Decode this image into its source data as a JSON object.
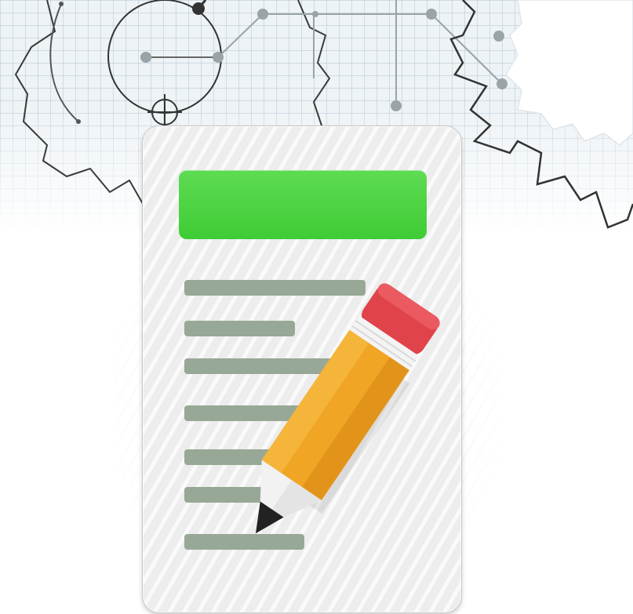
{
  "illustration": {
    "subject": "document-with-pencil",
    "colors": {
      "header_bar": "#46d03c",
      "text_line": "#98a896",
      "paper": "#ededed",
      "pencil_body": "#f0a524",
      "pencil_eraser": "#e0434a",
      "pencil_ferrule": "#f4f4f4",
      "pencil_lead": "#222222",
      "gear_outline": "#333333",
      "gear_fill": "#ffffff"
    },
    "icons": [
      "gear-icon",
      "document-icon",
      "pencil-icon",
      "compass-circle-icon"
    ],
    "text_line_count": 7
  }
}
